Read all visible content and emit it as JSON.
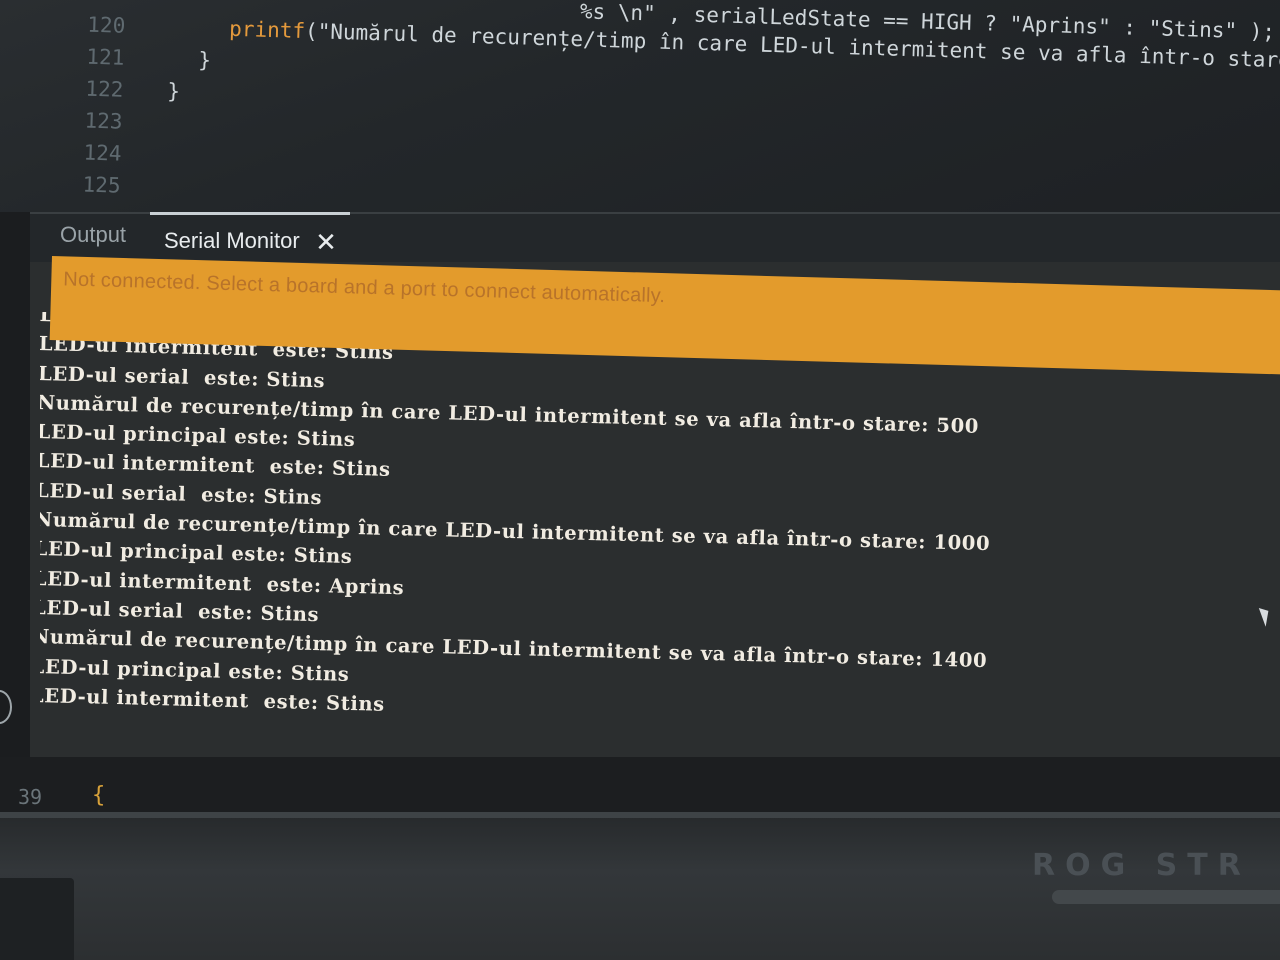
{
  "editor": {
    "lines": [
      {
        "num": "120",
        "segments": [
          {
            "t": "printf",
            "c": "kw"
          },
          {
            "t": "(\"Numărul de recurențe/timp în care LED-ul intermitent se va afla într-o stare: %",
            "c": ""
          }
        ]
      },
      {
        "num": "121",
        "segments": [
          {
            "t": "}",
            "c": ""
          }
        ]
      },
      {
        "num": "122",
        "segments": [
          {
            "t": "}",
            "c": ""
          }
        ]
      },
      {
        "num": "123",
        "segments": []
      },
      {
        "num": "124",
        "segments": []
      },
      {
        "num": "125",
        "segments": []
      }
    ],
    "partial_top_line": "%s \\n\" , serialLedState == HIGH ? \"Aprins\" : \"Stins\" );",
    "partial_top_right": "HIGH ? \"Aprins\" : \"Stins\" );"
  },
  "tabs": {
    "output_label": "Output",
    "serial_monitor_label": "Serial Monitor",
    "close_glyph": "✕"
  },
  "banner": {
    "message": "Not connected. Select a board and a port to connect automatically."
  },
  "serial_log": [
    "LED-ul principal este: Stins",
    "LED-ul intermitent  este: Stins",
    "LED-ul serial  este: Stins",
    "Numărul de recurențe/timp în care LED-ul intermitent se va afla într-o stare: 500",
    "LED-ul principal este: Stins",
    "LED-ul intermitent  este: Stins",
    "LED-ul serial  este: Stins",
    "Numărul de recurențe/timp în care LED-ul intermitent se va afla într-o stare: 1000",
    "LED-ul principal este: Stins",
    "LED-ul intermitent  este: Aprins",
    "LED-ul serial  este: Stins",
    "Numărul de recurențe/timp în care LED-ul intermitent se va afla într-o stare: 1400",
    "LED-ul principal este: Stins",
    "LED-ul intermitent  este: Stins"
  ],
  "bottom": {
    "line_number": "39",
    "code": "{"
  },
  "bezel": {
    "brand": "ROG STR"
  },
  "colors": {
    "banner": "#e39b2c",
    "log_text": "#f1ece2",
    "keyword": "#e59a3c"
  }
}
